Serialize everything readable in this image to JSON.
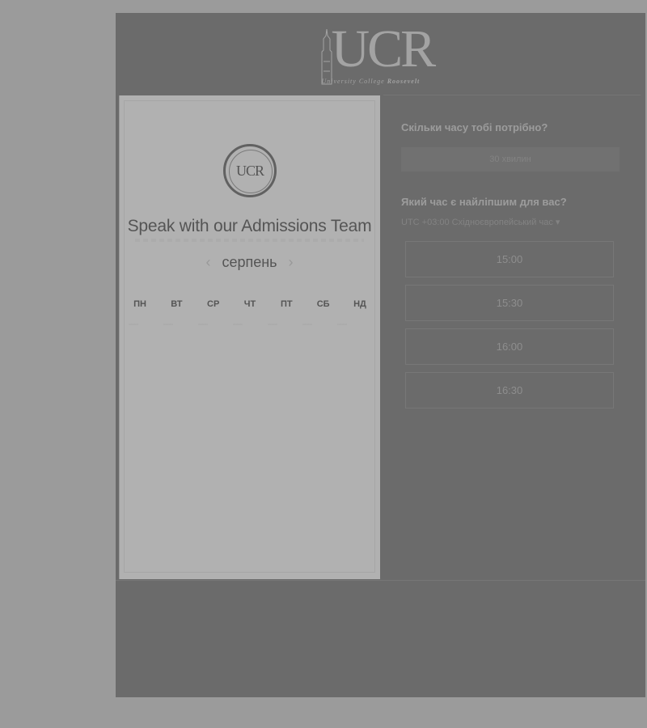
{
  "logo": {
    "letters": "UCR",
    "subtitle_prefix": "University College ",
    "subtitle_bold": "Roosevelt"
  },
  "card": {
    "seal_text": "UCR",
    "title": "Speak with our Admissions Team",
    "month": "серпень",
    "prev_icon": "chevron-left-icon",
    "next_icon": "chevron-right-icon",
    "weekdays": [
      "ПН",
      "ВТ",
      "СР",
      "ЧТ",
      "ПТ",
      "СБ",
      "НД"
    ]
  },
  "booking": {
    "duration_question": "Скільки часу тобі потрібно?",
    "duration_value": "30 хвилин",
    "time_question": "Який час є найліпшим для вас?",
    "timezone": "UTC +03:00 Східноєвропейський час",
    "slots": [
      "15:00",
      "15:30",
      "16:00",
      "16:30"
    ]
  }
}
